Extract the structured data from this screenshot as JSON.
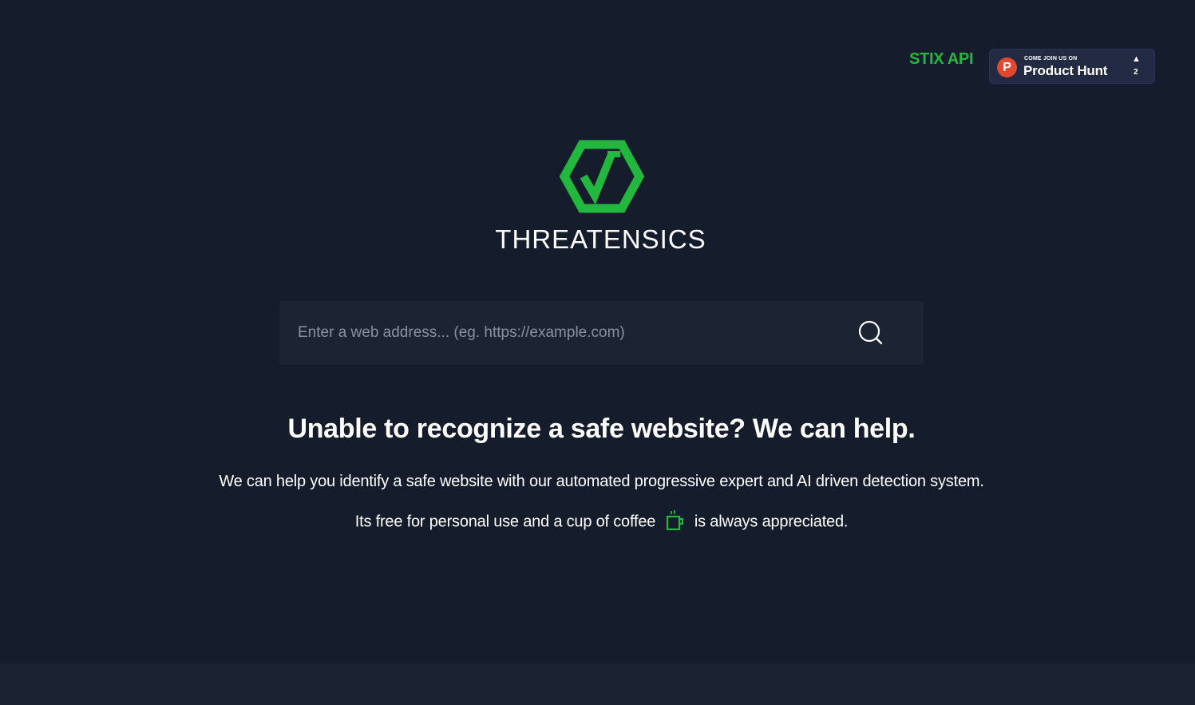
{
  "header": {
    "stix_link": "STIX API",
    "product_hunt": {
      "small_text": "COME JOIN US ON",
      "big_text": "Product Hunt",
      "logo_letter": "P",
      "arrow": "▲",
      "upvotes": "2"
    }
  },
  "brand": {
    "name": "THREATENSICS",
    "color": "#22b83f"
  },
  "search": {
    "placeholder": "Enter a web address... (eg. https://example.com)",
    "value": ""
  },
  "main": {
    "headline": "Unable to recognize a safe website? We can help.",
    "description": "We can help you identify a safe website with our automated progressive expert and AI driven detection system.",
    "coffee_before": "Its free for personal use and a cup of coffee",
    "coffee_after": "is always appreciated."
  },
  "icons": {
    "logo": "hexagon-check-icon",
    "search": "search-icon",
    "coffee": "coffee-cup-icon"
  }
}
